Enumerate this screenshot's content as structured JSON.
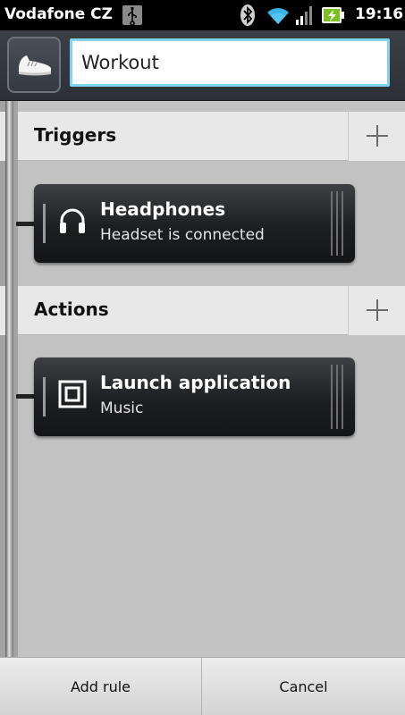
{
  "status_bar": {
    "carrier": "Vodafone CZ",
    "time": "19:16",
    "icons": [
      "usb-icon",
      "bluetooth-icon",
      "wifi-icon",
      "signal-icon",
      "battery-charging-icon"
    ]
  },
  "header": {
    "rule_icon": "sneaker-icon",
    "rule_name": "Workout"
  },
  "sections": [
    {
      "title": "Triggers",
      "add_icon": "plus-icon",
      "card": {
        "icon": "headphones-icon",
        "title": "Headphones",
        "subtitle": "Headset is connected"
      }
    },
    {
      "title": "Actions",
      "add_icon": "plus-icon",
      "card": {
        "icon": "application-icon",
        "title": "Launch application",
        "subtitle": "Music"
      }
    }
  ],
  "buttons": {
    "add_rule": "Add rule",
    "cancel": "Cancel"
  },
  "colors": {
    "input_focus": "#7fd2f0",
    "card_bg": "#1d1e21",
    "section_bg": "#e8e8e8",
    "background": "#c2c2c2"
  }
}
